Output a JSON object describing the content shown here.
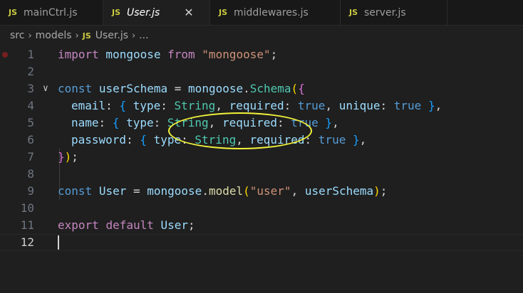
{
  "tabs": [
    {
      "icon": "JS",
      "label": "mainCtrl.js",
      "active": false
    },
    {
      "icon": "JS",
      "label": "User.js",
      "active": true,
      "close": "✕"
    },
    {
      "icon": "JS",
      "label": "middlewares.js",
      "active": false
    },
    {
      "icon": "JS",
      "label": "server.js",
      "active": false
    }
  ],
  "breadcrumb": {
    "parts": [
      "src",
      "models"
    ],
    "file_icon": "JS",
    "file": "User.js",
    "tail": "...",
    "separator": "›"
  },
  "editor": {
    "line_numbers": [
      "1",
      "2",
      "3",
      "4",
      "5",
      "6",
      "7",
      "8",
      "9",
      "10",
      "11",
      "12"
    ],
    "tokens": {
      "l1": [
        "import",
        " mongoose ",
        "from",
        " ",
        "\"mongoose\"",
        ";"
      ],
      "l3": [
        "const",
        " ",
        "userSchema",
        " = ",
        "mongoose",
        ".",
        "Schema",
        "(",
        "{"
      ],
      "l4": [
        "email",
        ": ",
        "{",
        " ",
        "type",
        ": ",
        "String",
        ", ",
        "required",
        ": ",
        "true",
        ", ",
        "unique",
        ": ",
        "true",
        " ",
        "}",
        ","
      ],
      "l5": [
        "name",
        ": ",
        "{",
        " ",
        "type",
        ": ",
        "String",
        ", ",
        "required",
        ": ",
        "true",
        " ",
        "}",
        ","
      ],
      "l6": [
        "password",
        ": ",
        "{",
        " ",
        "type",
        ": ",
        "String",
        ", ",
        "required",
        ": ",
        "true",
        " ",
        "}",
        ","
      ],
      "l7": [
        "}",
        ")",
        ";"
      ],
      "l9": [
        "const",
        " ",
        "User",
        " = ",
        "mongoose",
        ".",
        "model",
        "(",
        "\"user\"",
        ", ",
        "userSchema",
        ")",
        ";"
      ],
      "l11": [
        "export",
        " ",
        "default",
        " ",
        "User",
        ";"
      ]
    }
  },
  "colors": {
    "background": "#1f1f1f",
    "annotation": "#f2f23a",
    "breakpoint": "#7a1f1f"
  }
}
